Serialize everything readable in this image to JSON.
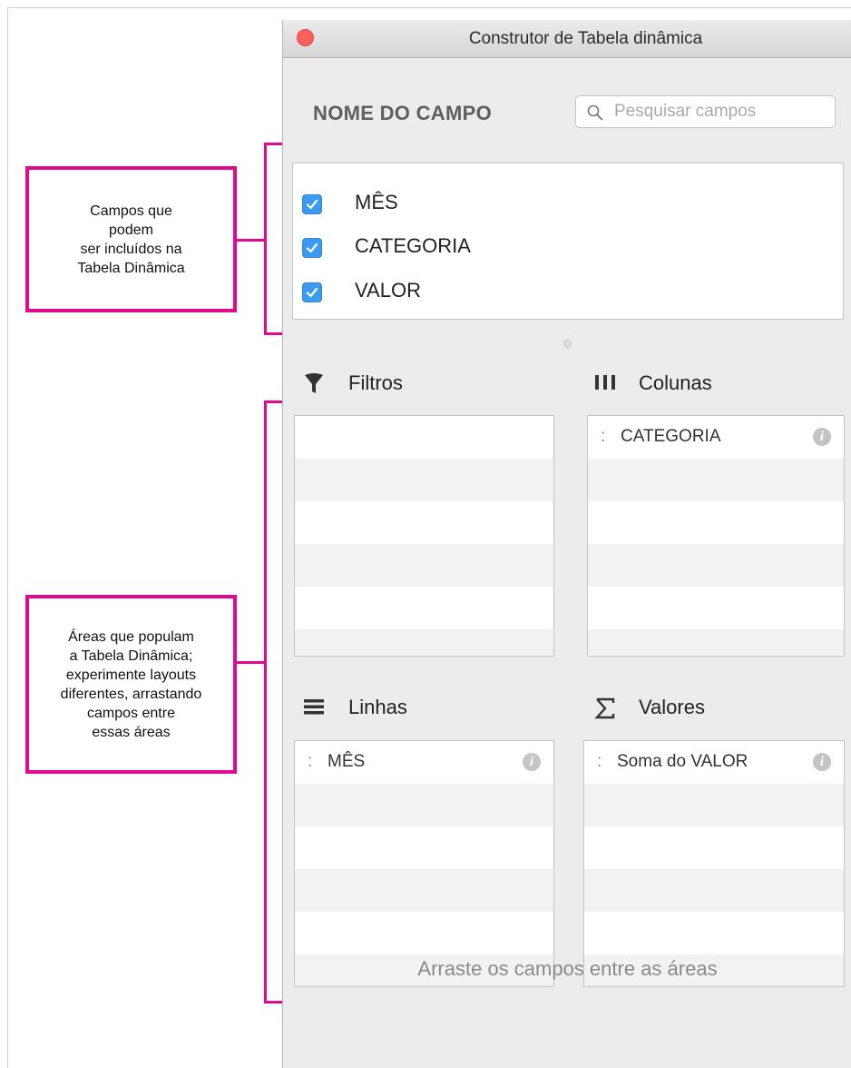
{
  "window": {
    "title": "Construtor de Tabela dinâmica"
  },
  "field_section": {
    "header": "NOME DO CAMPO",
    "search_placeholder": "Pesquisar campos",
    "fields": [
      {
        "label": "MÊS",
        "checked": true
      },
      {
        "label": "CATEGORIA",
        "checked": true
      },
      {
        "label": "VALOR",
        "checked": true
      }
    ]
  },
  "areas": {
    "filters": {
      "title": "Filtros",
      "items": []
    },
    "columns": {
      "title": "Colunas",
      "items": [
        {
          "label": "CATEGORIA"
        }
      ]
    },
    "rows": {
      "title": "Linhas",
      "items": [
        {
          "label": "MÊS"
        }
      ]
    },
    "values": {
      "title": "Valores",
      "items": [
        {
          "label": "Soma do VALOR"
        }
      ]
    }
  },
  "footer_hint": "Arraste os campos entre as áreas",
  "annotations": {
    "fields_callout": "Campos que\npodem\nser incluídos na\nTabela Dinâmica",
    "areas_callout": "Áreas que populam\na Tabela Dinâmica;\nexperimente layouts\ndiferentes, arrastando\ncampos entre\nessas áreas"
  },
  "colors": {
    "annotation_accent": "#e2098e",
    "checkbox_blue": "#3a9bf0",
    "close_button": "#fc605c"
  },
  "icons": [
    "close-icon",
    "search-icon",
    "check-icon",
    "filter-icon",
    "columns-icon",
    "rows-icon",
    "sigma-icon",
    "drag-handle-icon",
    "info-icon"
  ]
}
